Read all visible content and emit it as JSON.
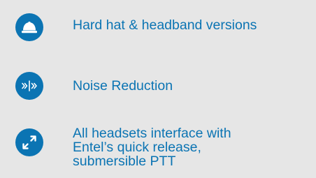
{
  "colors": {
    "background": "#e6e6e6",
    "accent": "#0b74b3",
    "icon_glyph": "#ffffff"
  },
  "features": [
    {
      "icon": "hard-hat-icon",
      "lines": [
        "Hard hat & headband versions"
      ]
    },
    {
      "icon": "noise-reduction-icon",
      "lines": [
        "Noise Reduction"
      ]
    },
    {
      "icon": "expand-arrows-icon",
      "lines": [
        "All headsets interface with",
        "Entel’s quick release,",
        "submersible PTT"
      ]
    }
  ]
}
